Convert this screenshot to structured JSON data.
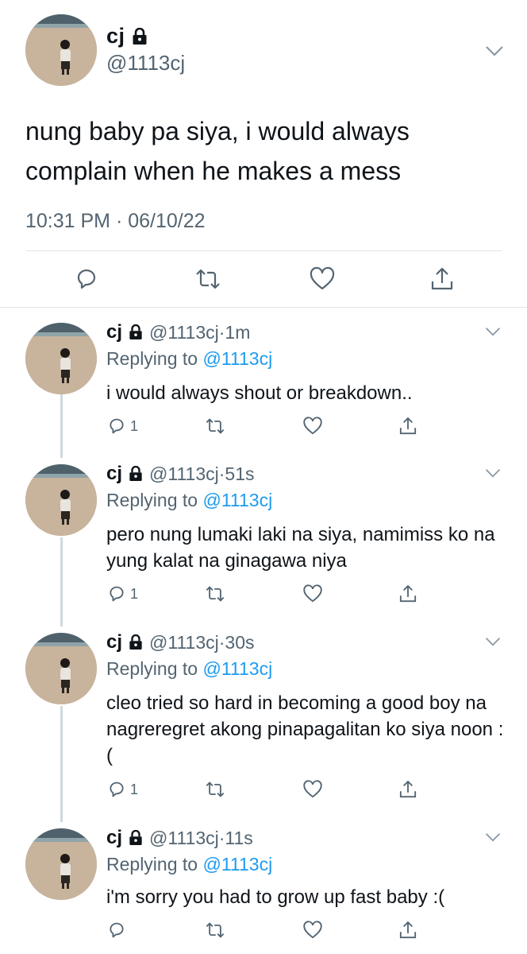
{
  "main_tweet": {
    "name": "cj",
    "handle": "@1113cj",
    "text": "nung baby pa siya, i would always complain when he makes a mess",
    "timestamp": "10:31 PM · 06/10/22"
  },
  "replies": [
    {
      "name": "cj",
      "handle": "@1113cj",
      "dot": "·",
      "time": "1m",
      "replying_prefix": "Replying to ",
      "replying_to": "@1113cj",
      "text": "i would always shout or breakdown..",
      "reply_count": "1"
    },
    {
      "name": "cj",
      "handle": "@1113cj",
      "dot": "·",
      "time": "51s",
      "replying_prefix": "Replying to ",
      "replying_to": "@1113cj",
      "text": "pero nung lumaki laki na siya, namimiss ko na yung kalat na ginagawa niya",
      "reply_count": "1"
    },
    {
      "name": "cj",
      "handle": "@1113cj",
      "dot": "·",
      "time": "30s",
      "replying_prefix": "Replying to ",
      "replying_to": "@1113cj",
      "text": "cleo tried so hard in becoming a good boy na nagreregret akong pinapagalitan ko siya noon :(",
      "reply_count": "1"
    },
    {
      "name": "cj",
      "handle": "@1113cj",
      "dot": "·",
      "time": "11s",
      "replying_prefix": "Replying to ",
      "replying_to": "@1113cj",
      "text": "i'm sorry you had to grow up fast baby :(",
      "reply_count": ""
    }
  ],
  "icons": {
    "lock": "lock-icon",
    "caret": "chevron-down-icon",
    "reply": "reply-icon",
    "retweet": "retweet-icon",
    "like": "heart-icon",
    "share": "share-icon"
  },
  "colors": {
    "text": "#0f1419",
    "secondary": "#536471",
    "link": "#1d9bf0",
    "divider": "#e1e5e8",
    "thread_line": "#cfd9de"
  }
}
